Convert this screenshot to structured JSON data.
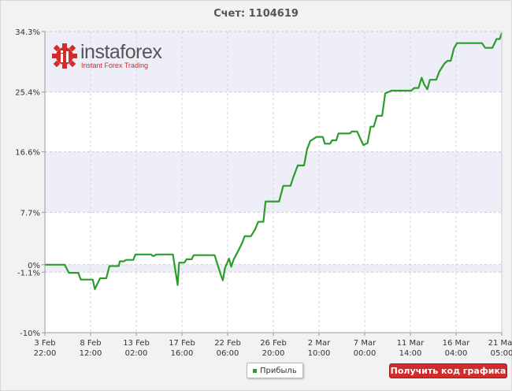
{
  "chart_data": {
    "type": "line",
    "title": "Счет: 1104619",
    "xlabel": "",
    "ylabel": "",
    "ylim": [
      -10,
      34.3
    ],
    "y_ticks": [
      "34.3%",
      "25.4%",
      "16.6%",
      "7.7%",
      "0%",
      "-1.1%",
      "-10%"
    ],
    "y_tick_values": [
      34.3,
      25.4,
      16.6,
      7.7,
      0,
      -1.1,
      -10
    ],
    "x_ticks": [
      {
        "l1": "3 Feb",
        "l2": "22:00"
      },
      {
        "l1": "8 Feb",
        "l2": "12:00"
      },
      {
        "l1": "13 Feb",
        "l2": "02:00"
      },
      {
        "l1": "17 Feb",
        "l2": "16:00"
      },
      {
        "l1": "22 Feb",
        "l2": "06:00"
      },
      {
        "l1": "26 Feb",
        "l2": "20:00"
      },
      {
        "l1": "2 Mar",
        "l2": "10:00"
      },
      {
        "l1": "7 Mar",
        "l2": "00:00"
      },
      {
        "l1": "11 Mar",
        "l2": "14:00"
      },
      {
        "l1": "16 Mar",
        "l2": "04:00"
      },
      {
        "l1": "21 Mar",
        "l2": "05:00"
      }
    ],
    "series": [
      {
        "name": "Прибыль",
        "color": "#2a9d2a",
        "points": [
          [
            0,
            0
          ],
          [
            1.9,
            0
          ],
          [
            2.3,
            -1.2
          ],
          [
            3.2,
            -1.2
          ],
          [
            3.45,
            -2.2
          ],
          [
            4.6,
            -2.2
          ],
          [
            4.8,
            -3.6
          ],
          [
            5.3,
            -2.0
          ],
          [
            5.9,
            -2.0
          ],
          [
            6.2,
            -0.2
          ],
          [
            7.1,
            -0.2
          ],
          [
            7.2,
            0.5
          ],
          [
            7.6,
            0.5
          ],
          [
            7.8,
            0.7
          ],
          [
            8.5,
            0.7
          ],
          [
            8.7,
            1.5
          ],
          [
            10.2,
            1.5
          ],
          [
            10.35,
            1.3
          ],
          [
            10.5,
            1.3
          ],
          [
            10.7,
            1.5
          ],
          [
            12.3,
            1.5
          ],
          [
            12.6,
            -1.5
          ],
          [
            12.75,
            -3.0
          ],
          [
            12.9,
            0.3
          ],
          [
            13.4,
            0.3
          ],
          [
            13.6,
            0.8
          ],
          [
            14.1,
            0.8
          ],
          [
            14.3,
            1.4
          ],
          [
            16.3,
            1.4
          ],
          [
            16.6,
            0.0
          ],
          [
            16.9,
            -1.5
          ],
          [
            17.1,
            -2.3
          ],
          [
            17.3,
            -0.5
          ],
          [
            17.5,
            0.2
          ],
          [
            17.7,
            0.9
          ],
          [
            17.9,
            -0.3
          ],
          [
            18.15,
            0.8
          ],
          [
            18.5,
            1.8
          ],
          [
            18.9,
            3.0
          ],
          [
            19.2,
            4.2
          ],
          [
            19.8,
            4.2
          ],
          [
            20.2,
            5.2
          ],
          [
            20.5,
            6.3
          ],
          [
            21.0,
            6.3
          ],
          [
            21.2,
            9.3
          ],
          [
            22.5,
            9.3
          ],
          [
            22.9,
            11.6
          ],
          [
            23.6,
            11.6
          ],
          [
            23.9,
            13.0
          ],
          [
            24.3,
            14.6
          ],
          [
            24.9,
            14.6
          ],
          [
            25.2,
            17.0
          ],
          [
            25.5,
            18.2
          ],
          [
            26.1,
            18.8
          ],
          [
            26.7,
            18.8
          ],
          [
            26.9,
            17.8
          ],
          [
            27.4,
            17.8
          ],
          [
            27.6,
            18.3
          ],
          [
            28.0,
            18.3
          ],
          [
            28.2,
            19.3
          ],
          [
            29.3,
            19.3
          ],
          [
            29.5,
            19.6
          ],
          [
            30.0,
            19.6
          ],
          [
            30.3,
            18.6
          ],
          [
            30.6,
            17.6
          ],
          [
            31.0,
            17.9
          ],
          [
            31.3,
            20.3
          ],
          [
            31.6,
            20.3
          ],
          [
            31.9,
            21.9
          ],
          [
            32.4,
            21.9
          ],
          [
            32.7,
            25.2
          ],
          [
            33.3,
            25.6
          ],
          [
            35.2,
            25.6
          ],
          [
            35.5,
            26.0
          ],
          [
            35.9,
            26.0
          ],
          [
            36.2,
            27.5
          ],
          [
            36.45,
            26.5
          ],
          [
            36.75,
            25.8
          ],
          [
            37.0,
            27.2
          ],
          [
            37.6,
            27.2
          ],
          [
            37.9,
            28.4
          ],
          [
            38.4,
            29.6
          ],
          [
            38.7,
            30.0
          ],
          [
            39.0,
            30.0
          ],
          [
            39.3,
            31.8
          ],
          [
            39.6,
            32.6
          ],
          [
            42.0,
            32.6
          ],
          [
            42.3,
            31.9
          ],
          [
            43.0,
            31.9
          ],
          [
            43.4,
            33.2
          ],
          [
            43.7,
            33.2
          ],
          [
            43.9,
            34.1
          ]
        ]
      }
    ]
  },
  "legend": {
    "label": "Прибыль"
  },
  "button": {
    "label": "Получить код графика"
  },
  "logo": {
    "name": "instaforex",
    "tagline": "Instant Forex Trading"
  },
  "colors": {
    "line": "#2a9d2a",
    "band": "#eeeef8",
    "button": "#d22b2b"
  }
}
